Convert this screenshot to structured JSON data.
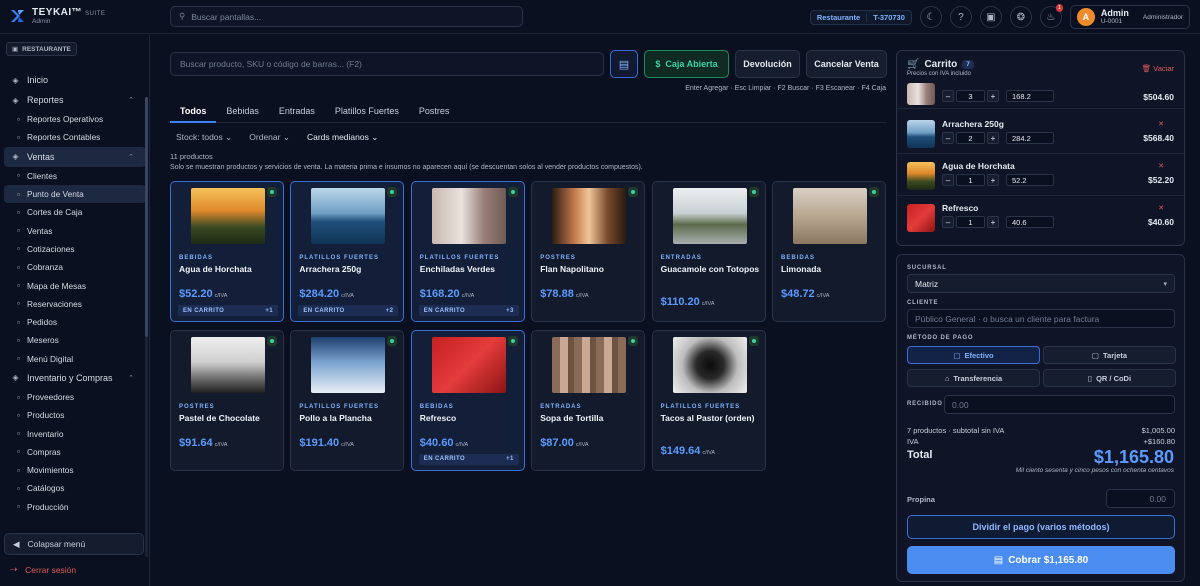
{
  "brand": {
    "name": "TEYKAI",
    "tm": "™",
    "suite": "SUITE",
    "sub": "Admin"
  },
  "top_search": {
    "placeholder": "Buscar pantallas..."
  },
  "context": {
    "mode": "Restaurante",
    "terminal": "T-370730"
  },
  "notifications": {
    "count": "1"
  },
  "user": {
    "initial": "A",
    "name": "Admin",
    "id": "U-0001",
    "role": "Administrador"
  },
  "sidebar": {
    "restaurant_pill": "RESTAURANTE",
    "items": [
      {
        "label": "Inicio",
        "icon": "home-icon",
        "level": "section"
      },
      {
        "label": "Reportes",
        "icon": "chart-icon",
        "level": "section",
        "expanded": true
      },
      {
        "label": "Reportes Operativos",
        "icon": "report-icon",
        "level": "sub"
      },
      {
        "label": "Reportes Contables",
        "icon": "calculator-icon",
        "level": "sub"
      },
      {
        "label": "Ventas",
        "icon": "cart-icon",
        "level": "section",
        "expanded": true,
        "active": true
      },
      {
        "label": "Clientes",
        "icon": "users-icon",
        "level": "sub"
      },
      {
        "label": "Punto de Venta",
        "icon": "register-icon",
        "level": "sub",
        "active": true
      },
      {
        "label": "Cortes de Caja",
        "icon": "scissors-icon",
        "level": "sub"
      },
      {
        "label": "Ventas",
        "icon": "receipt-icon",
        "level": "sub"
      },
      {
        "label": "Cotizaciones",
        "icon": "document-icon",
        "level": "sub"
      },
      {
        "label": "Cobranza",
        "icon": "card-icon",
        "level": "sub"
      },
      {
        "label": "Mapa de Mesas",
        "icon": "table-map-icon",
        "level": "sub"
      },
      {
        "label": "Reservaciones",
        "icon": "calendar-icon",
        "level": "sub"
      },
      {
        "label": "Pedidos",
        "icon": "bag-icon",
        "level": "sub"
      },
      {
        "label": "Meseros",
        "icon": "waiter-icon",
        "level": "sub"
      },
      {
        "label": "Menú Digital",
        "icon": "phone-icon",
        "level": "sub"
      },
      {
        "label": "Inventario y Compras",
        "icon": "box-icon",
        "level": "section",
        "expanded": true
      },
      {
        "label": "Proveedores",
        "icon": "truck-icon",
        "level": "sub"
      },
      {
        "label": "Productos",
        "icon": "package-icon",
        "level": "sub"
      },
      {
        "label": "Inventario",
        "icon": "warehouse-icon",
        "level": "sub"
      },
      {
        "label": "Compras",
        "icon": "shopping-icon",
        "level": "sub"
      },
      {
        "label": "Movimientos",
        "icon": "arrows-icon",
        "level": "sub"
      },
      {
        "label": "Catálogos",
        "icon": "folder-icon",
        "level": "sub"
      },
      {
        "label": "Producción",
        "icon": "factory-icon",
        "level": "sub"
      }
    ],
    "collapse_label": "Colapsar menú",
    "logout_label": "Cerrar sesión"
  },
  "pos": {
    "search_placeholder": "Buscar producto, SKU o código de barras... (F2)",
    "buttons": {
      "open_register": "Caja Abierta",
      "return": "Devolución",
      "cancel": "Cancelar Venta"
    },
    "shortcuts": "Enter Agregar · Esc Limpiar · F2 Buscar · F3 Escanear · F4 Caja",
    "tabs": [
      "Todos",
      "Bebidas",
      "Entradas",
      "Platillos Fuertes",
      "Postres"
    ],
    "active_tab": "Todos",
    "filters": {
      "stock": "Stock: todos",
      "sort": "Ordenar",
      "cards": "Cards medianos"
    },
    "count_text": "11 productos",
    "note": "Solo se muestran productos y servicios de venta. La materia prima e insumos no aparecen aquí (se descuentan solos al vender productos compuestos).",
    "iva_suffix": "c/IVA",
    "in_cart_label": "EN CARRITO",
    "products": [
      {
        "category": "BEBIDAS",
        "name": "Agua de Horchata",
        "price": "$52.20",
        "in_cart": true,
        "qty": "+1",
        "img": "sunset"
      },
      {
        "category": "PLATILLOS FUERTES",
        "name": "Arrachera 250g",
        "price": "$284.20",
        "in_cart": true,
        "qty": "+2",
        "img": "sea"
      },
      {
        "category": "PLATILLOS FUERTES",
        "name": "Enchiladas Verdes",
        "price": "$168.20",
        "in_cart": true,
        "qty": "+3",
        "img": "forest"
      },
      {
        "category": "POSTRES",
        "name": "Flan Napolitano",
        "price": "$78.88",
        "in_cart": false,
        "img": "window"
      },
      {
        "category": "ENTRADAS",
        "name": "Guacamole con Totopos",
        "price": "$110.20",
        "in_cart": false,
        "img": "road"
      },
      {
        "category": "BEBIDAS",
        "name": "Limonada",
        "price": "$48.72",
        "in_cart": false,
        "img": "deer"
      },
      {
        "category": "POSTRES",
        "name": "Pastel de Chocolate",
        "price": "$91.64",
        "in_cart": false,
        "img": "fog"
      },
      {
        "category": "PLATILLOS FUERTES",
        "name": "Pollo a la Plancha",
        "price": "$191.40",
        "in_cart": false,
        "img": "birds"
      },
      {
        "category": "BEBIDAS",
        "name": "Refresco",
        "price": "$40.60",
        "in_cart": true,
        "qty": "+1",
        "img": "red"
      },
      {
        "category": "ENTRADAS",
        "name": "Sopa de Tortilla",
        "price": "$87.00",
        "in_cart": false,
        "img": "wall"
      },
      {
        "category": "PLATILLOS FUERTES",
        "name": "Tacos al Pastor (orden)",
        "price": "$149.64",
        "in_cart": false,
        "img": "tunnel"
      }
    ]
  },
  "cart": {
    "title": "Carrito",
    "count": "7",
    "subtitle": "Precios con IVA incluido",
    "clear_label": "Vaciar",
    "items": [
      {
        "name": "",
        "qty": "3",
        "unit": "168.2",
        "total": "$504.60",
        "img": "forest",
        "partial": true
      },
      {
        "name": "Arrachera 250g",
        "qty": "2",
        "unit": "284.2",
        "total": "$568.40",
        "img": "sea"
      },
      {
        "name": "Agua de Horchata",
        "qty": "1",
        "unit": "52.2",
        "total": "$52.20",
        "img": "sunset"
      },
      {
        "name": "Refresco",
        "qty": "1",
        "unit": "40.6",
        "total": "$40.60",
        "img": "red"
      }
    ]
  },
  "checkout": {
    "branch_label": "SUCURSAL",
    "branch_value": "Matriz",
    "client_label": "CLIENTE",
    "client_placeholder": "Público General · o busca un cliente para factura",
    "method_label": "MÉTODO DE PAGO",
    "methods": [
      "Efectivo",
      "Tarjeta",
      "Transferencia",
      "QR / CoDi"
    ],
    "active_method": "Efectivo",
    "received_label": "RECIBIDO",
    "received_placeholder": "0.00",
    "subtotal_label": "7 productos · subtotal sin IVA",
    "subtotal_value": "$1,005.00",
    "iva_label": "IVA",
    "iva_value": "+$160.80",
    "total_label": "Total",
    "total_value": "$1,165.80",
    "total_words": "Mil ciento sesenta y cinco pesos con ochenta centavos",
    "tip_label": "Propina",
    "tip_placeholder": "0.00",
    "split_label": "Dividir el pago (varios métodos)",
    "pay_label": "Cobrar $1,165.80"
  },
  "colors": {
    "accent": "#3b82f6",
    "success": "#38d39f",
    "danger": "#e05a5a",
    "bg": "#0b1020"
  }
}
